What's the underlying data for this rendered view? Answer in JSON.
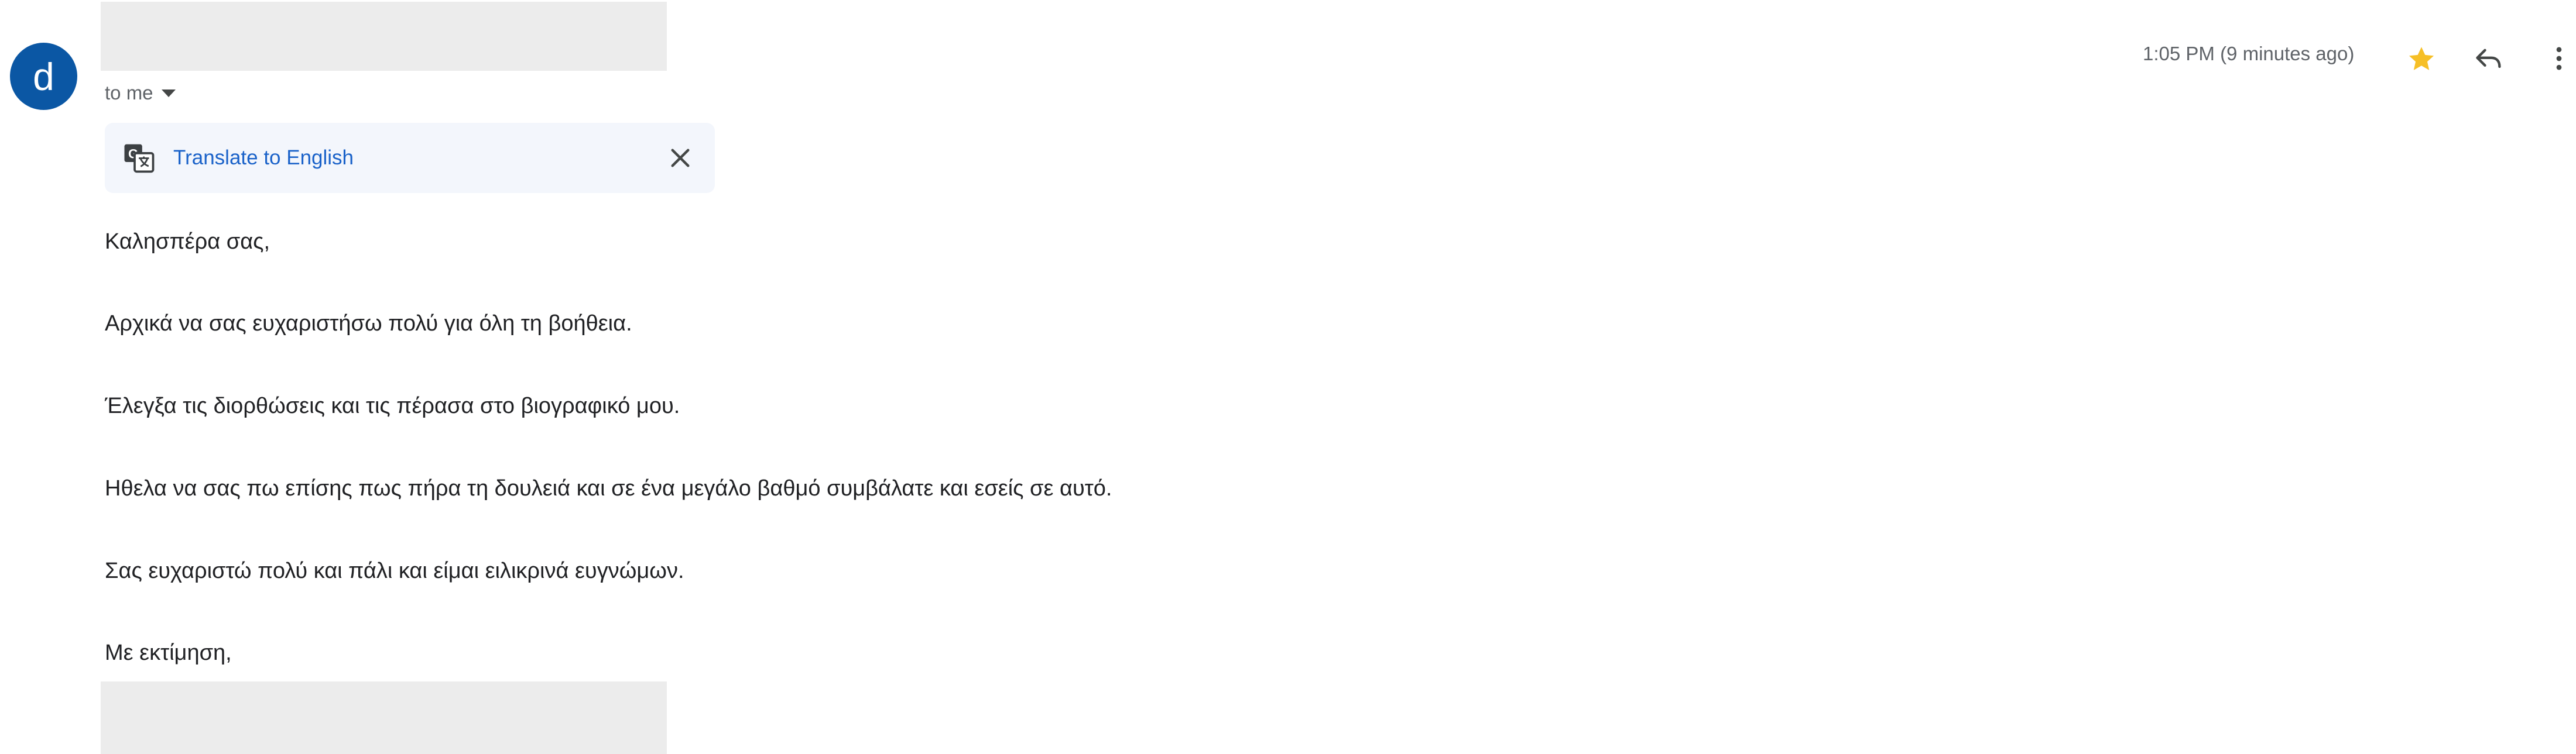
{
  "sender": {
    "avatar_letter": "d",
    "recipient_label": "to me"
  },
  "header": {
    "timestamp": "1:05 PM (9 minutes ago)"
  },
  "translate": {
    "link_label": "Translate to English"
  },
  "message": {
    "lines": [
      "Καλησπέρα σας,",
      "Αρχικά να σας ευχαριστήσω πολύ για όλη τη βοήθεια.",
      "Έλεγξα τις διορθώσεις και τις πέρασα στο βιογραφικό μου.",
      "Ηθελα να σας πω επίσης πως πήρα τη δουλειά και σε ένα μεγάλο βαθμό συμβάλατε και εσείς σε αυτό.",
      "Σας ευχαριστώ πολύ και πάλι και είμαι ειλικρινά ευγνώμων.",
      "Με εκτίμηση,"
    ]
  },
  "icons": {
    "star": "star-icon",
    "reply": "reply-icon",
    "more": "more-vert-icon",
    "translate": "translate-icon",
    "close": "close-icon",
    "caret": "chevron-down-icon"
  },
  "colors": {
    "avatar_bg": "#0b57a4",
    "star": "#f6bf26",
    "link": "#1a62c9",
    "translate_bar_bg": "#f3f6fc"
  }
}
